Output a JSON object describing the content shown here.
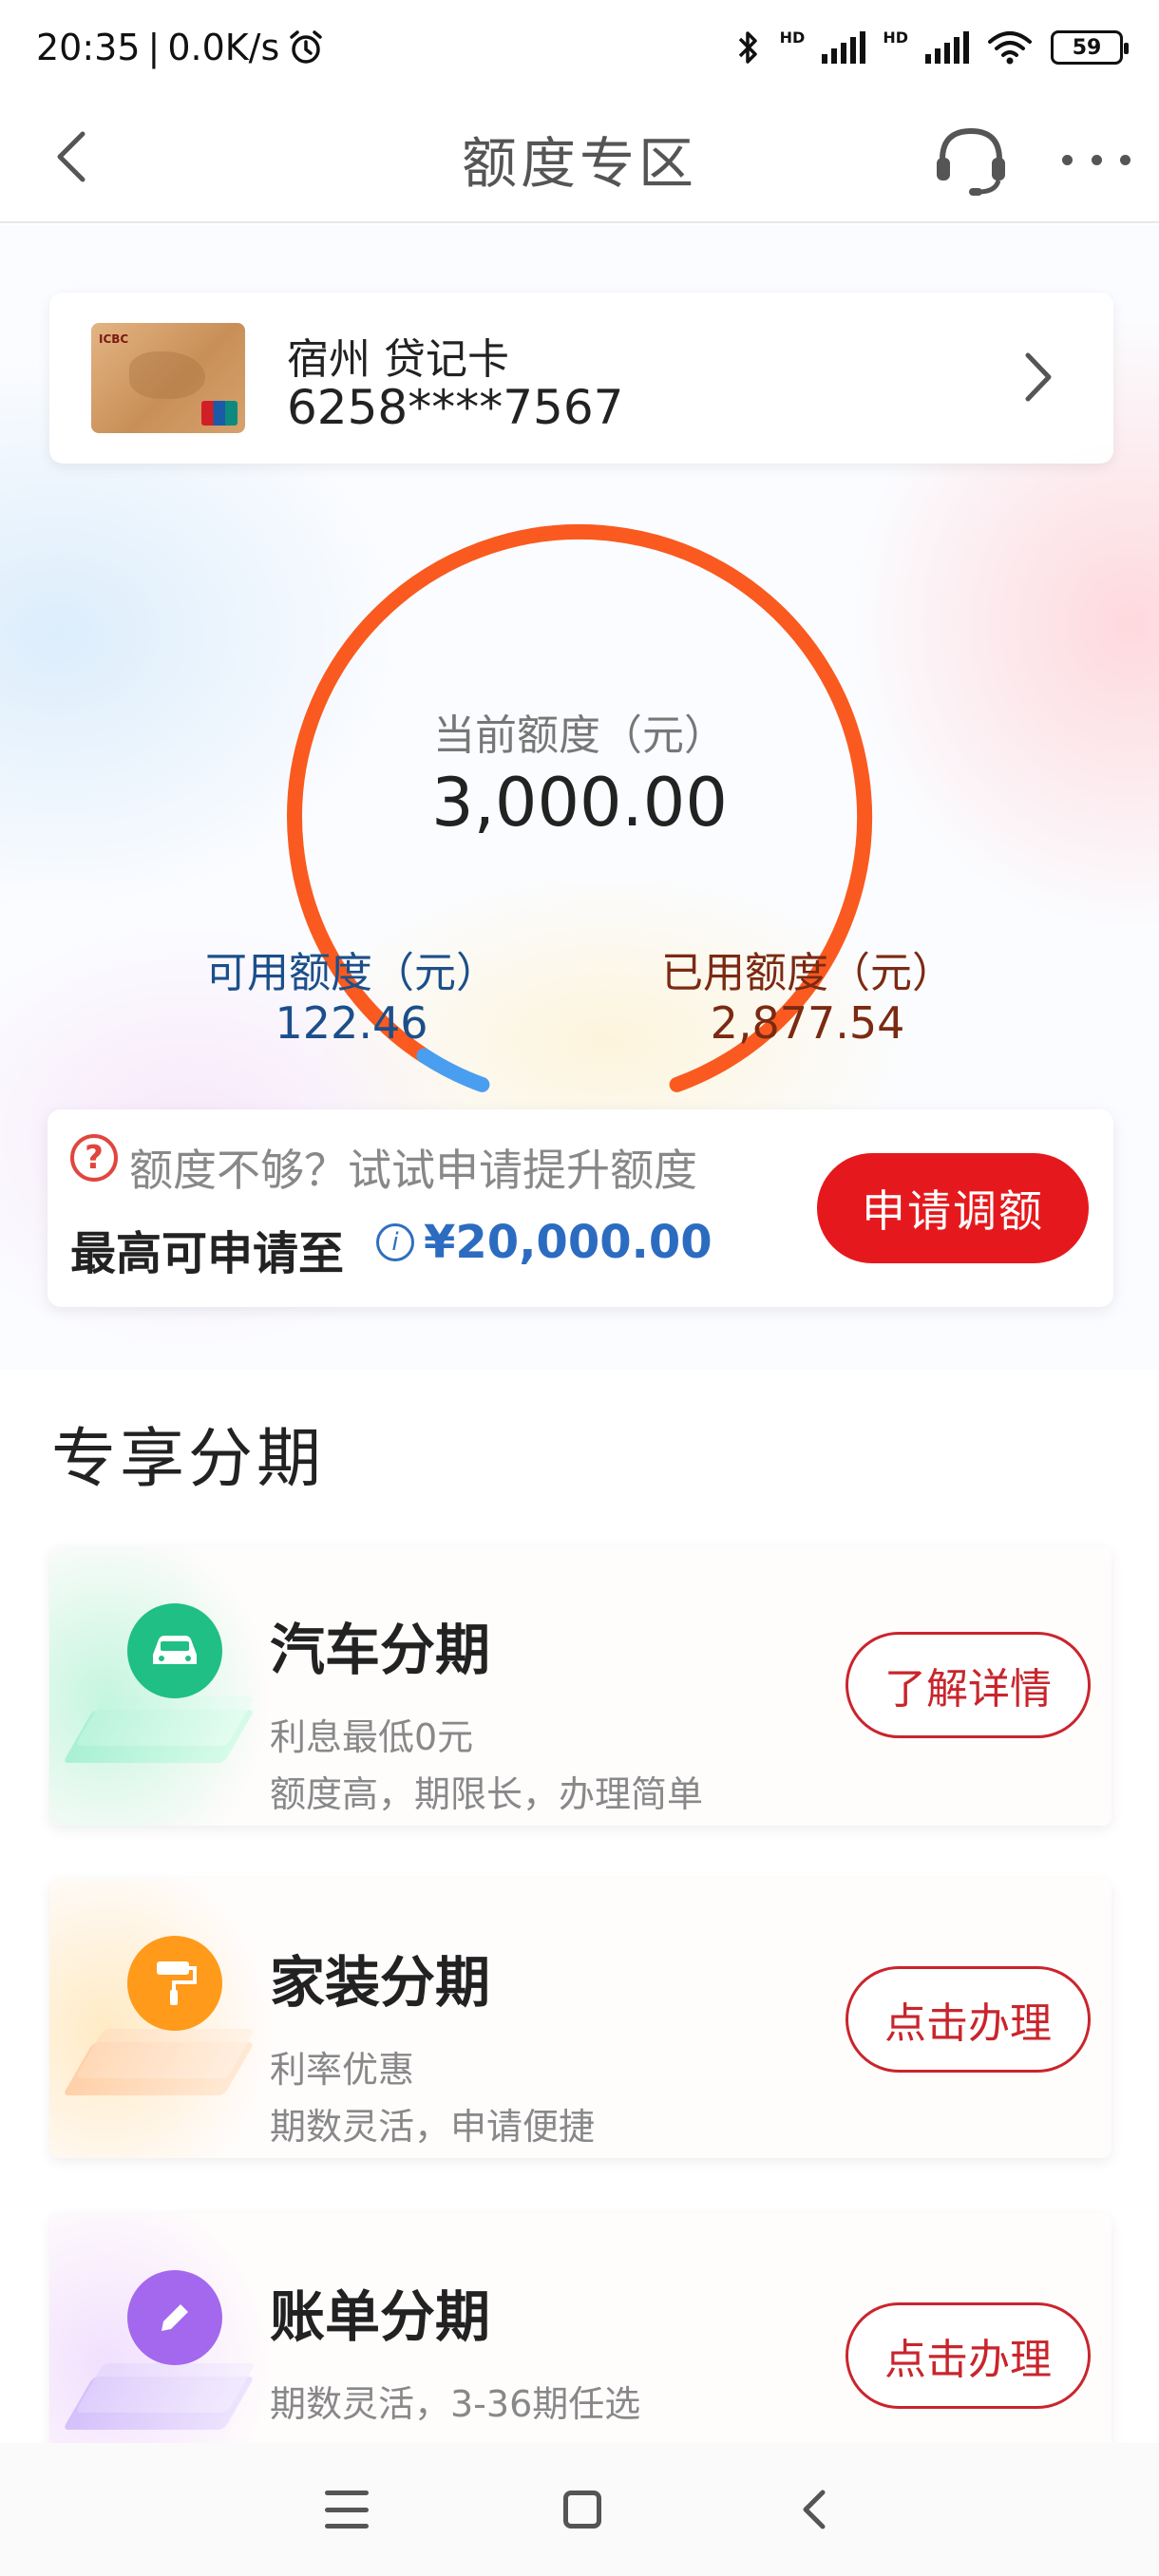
{
  "status": {
    "time": "20:35",
    "speed": "0.0K/s",
    "battery": "59",
    "hd1": "HD",
    "hd2": "HD"
  },
  "nav": {
    "title": "额度专区"
  },
  "card": {
    "name": "宿州 贷记卡",
    "number": "6258****7567"
  },
  "gauge": {
    "label": "当前额度（元）",
    "value": "3,000.00",
    "available_fraction": 0.0408,
    "available_color": "#4a9ef0",
    "used_color": "#fa5a1f"
  },
  "available": {
    "label": "可用额度（元）",
    "value": "122.46"
  },
  "used": {
    "label": "已用额度（元）",
    "value": "2,877.54"
  },
  "raise": {
    "question_icon": "?",
    "text": "额度不够？试试申请提升额度",
    "max_label": "最高可申请至",
    "info_icon": "i",
    "max_amount": "¥20,000.00",
    "button": "申请调额"
  },
  "section": {
    "title": "专享分期"
  },
  "installments": [
    {
      "title": "汽车分期",
      "desc1": "利息最低0元",
      "desc2": "额度高，期限长，办理简单",
      "button": "了解详情",
      "icon": "car-icon",
      "color": "#1fbf85"
    },
    {
      "title": "家装分期",
      "desc1": "利率优惠",
      "desc2": "期数灵活，申请便捷",
      "button": "点击办理",
      "icon": "paint-roller-icon",
      "color": "#ff9a1a"
    },
    {
      "title": "账单分期",
      "desc1": "期数灵活，3-36期任选",
      "desc2": "",
      "button": "点击办理",
      "icon": "pencil-icon",
      "color": "#a468ee"
    }
  ]
}
